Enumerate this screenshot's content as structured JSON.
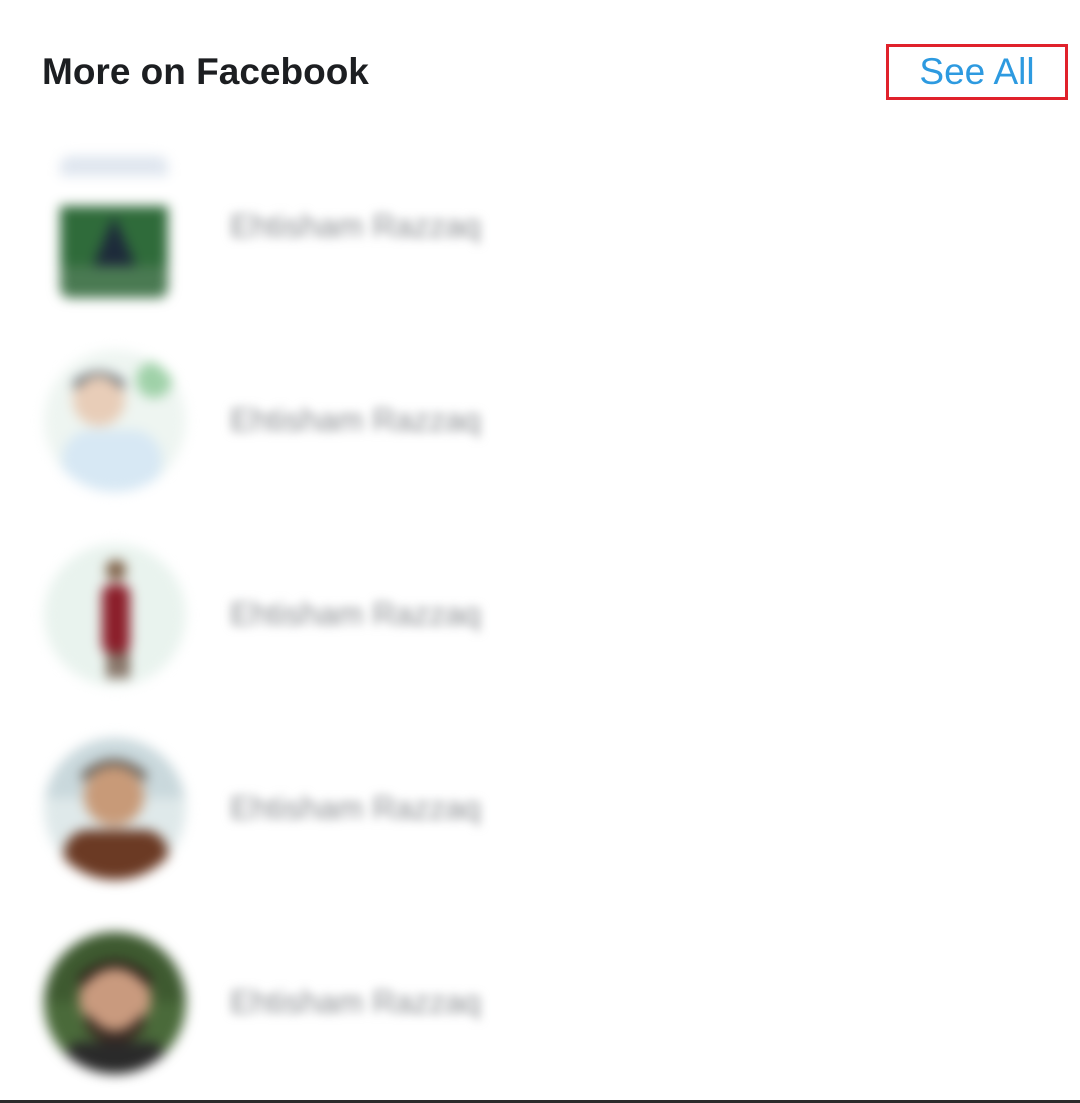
{
  "header": {
    "title": "More on Facebook",
    "see_all_label": "See All"
  },
  "friends": [
    {
      "name": "Ehtisham Razzaq",
      "avatar": "page-cover-avatar"
    },
    {
      "name": "Ehtisham Razzaq",
      "avatar": "profile-avatar"
    },
    {
      "name": "Ehtisham Razzaq",
      "avatar": "profile-avatar"
    },
    {
      "name": "Ehtisham Razzaq",
      "avatar": "profile-avatar"
    },
    {
      "name": "Ehtisham Razzaq",
      "avatar": "profile-avatar"
    }
  ],
  "colors": {
    "accent": "#2d9ae0",
    "highlight_box": "#e0212b",
    "title": "#1c1e21"
  }
}
